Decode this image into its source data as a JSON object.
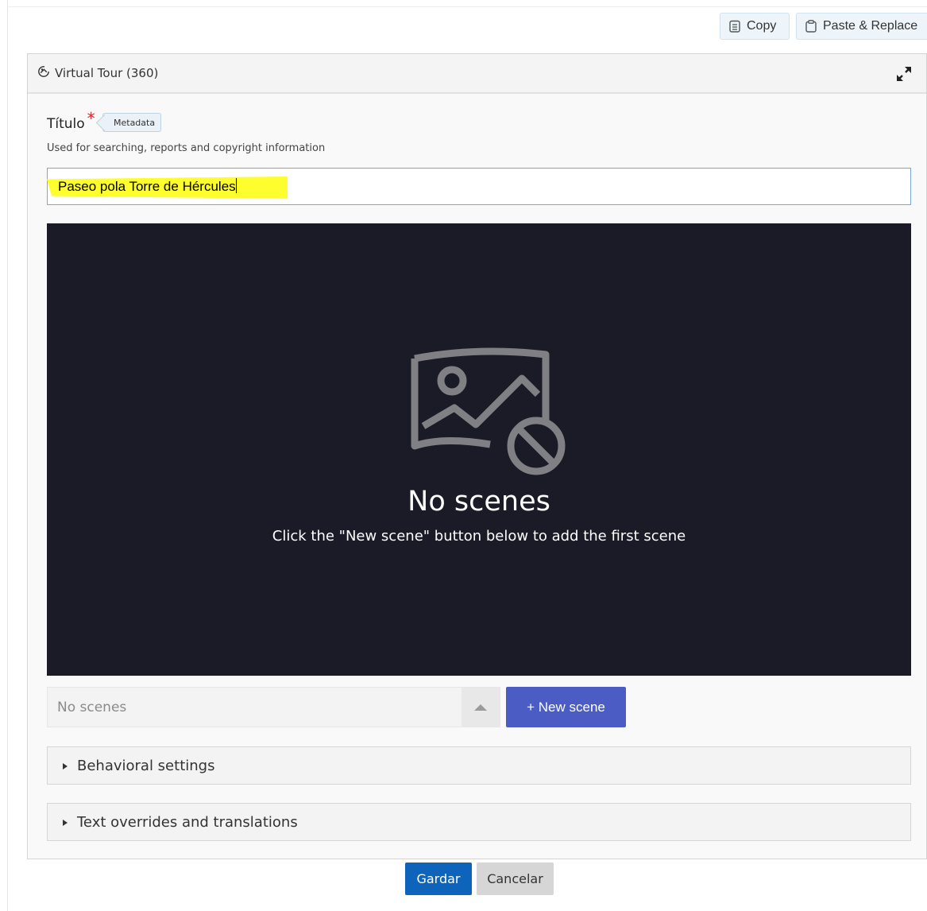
{
  "toolbar": {
    "copy_label": "Copy",
    "copy_icon": "clipboard-copy-icon",
    "paste_label": "Paste & Replace",
    "paste_icon": "clipboard-paste-icon"
  },
  "panel": {
    "title": "Virtual Tour (360)",
    "title_icon": "panorama-360-icon",
    "expand_icon": "expand-arrows-icon"
  },
  "field": {
    "label": "Título",
    "required_mark": "*",
    "metadata_button": "Metadata",
    "description": "Used for searching, reports and copyright information",
    "value": "Paseo pola Torre de Hércules"
  },
  "scenes": {
    "empty_icon": "image-unavailable-icon",
    "empty_title": "No scenes",
    "empty_hint": "Click the \"New scene\" button below to add the first scene",
    "select_value": "No scenes",
    "new_scene_label": "+ New scene"
  },
  "sections": [
    {
      "label": "Behavioral settings",
      "expanded": false
    },
    {
      "label": "Text overrides and translations",
      "expanded": false
    }
  ],
  "actions": {
    "save_label": "Gardar",
    "cancel_label": "Cancelar"
  },
  "colors": {
    "scene_background": "#1b1a27",
    "new_scene_button": "#4b5dc4",
    "save_button": "#0e64bb",
    "highlight": "#fefe2e",
    "required": "#d8262c"
  }
}
